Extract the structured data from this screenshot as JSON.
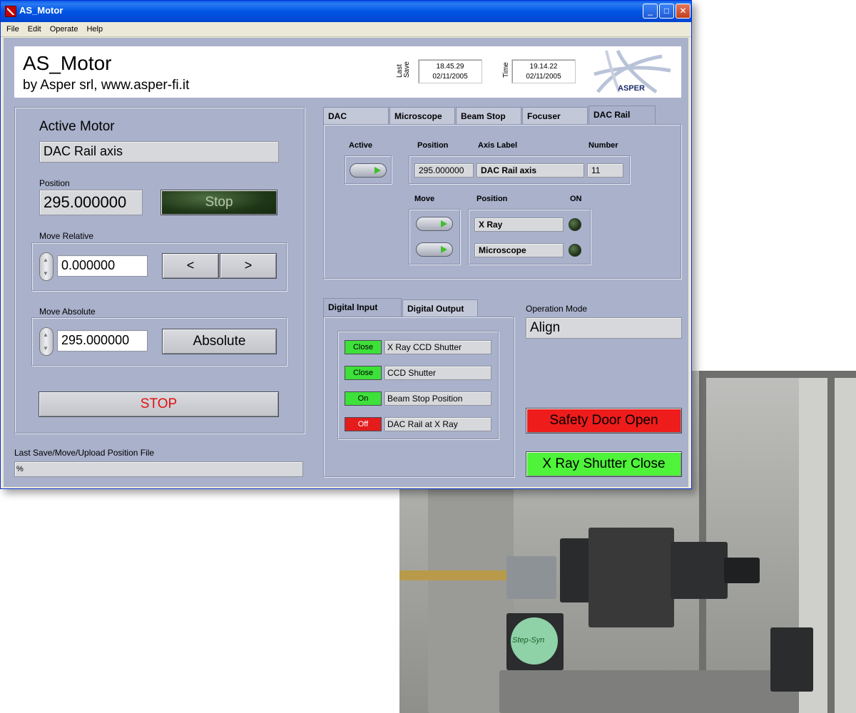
{
  "window": {
    "title": "AS_Motor",
    "buttons": [
      "_",
      "□",
      "✕"
    ]
  },
  "menu": [
    "File",
    "Edit",
    "Operate",
    "Help"
  ],
  "header": {
    "title": "AS_Motor",
    "subtitle": "by Asper srl, www.asper-fi.it",
    "last_save_label": "Last Save",
    "last_save_time": "18.45.29",
    "last_save_date": "02/11/2005",
    "time_label": "Time",
    "time_time": "19.14.22",
    "time_date": "02/11/2005",
    "logo_text": "ASPER"
  },
  "left": {
    "active_motor_label": "Active Motor",
    "active_motor_value": "DAC Rail axis",
    "position_label": "Position",
    "position_value": "295.000000",
    "stop_button": "Stop",
    "move_relative_label": "Move Relative",
    "move_relative_value": "0.000000",
    "left_button": "<",
    "right_button": ">",
    "move_absolute_label": "Move Absolute",
    "move_absolute_value": "295.000000",
    "absolute_button": "Absolute",
    "stop_all_button": "STOP",
    "last_file_label": "Last Save/Move/Upload Position File",
    "last_file_value": "%"
  },
  "axis_tabs": [
    "DAC",
    "Microscope",
    "Beam Stop",
    "Focuser",
    "DAC Rail"
  ],
  "dac_rail": {
    "active_label": "Active",
    "position_label": "Position",
    "axis_label_label": "Axis Label",
    "number_label": "Number",
    "position_value": "295.000000",
    "axis_label_value": "DAC Rail axis",
    "number_value": "11",
    "move_label": "Move",
    "position2_label": "Position",
    "on_label": "ON",
    "positions": [
      "X Ray",
      "Microscope"
    ]
  },
  "io_tabs": [
    "Digital Input",
    "Digital Output"
  ],
  "digital_inputs": [
    {
      "state": "Close",
      "label": "X Ray CCD Shutter",
      "color": "#3ee03a"
    },
    {
      "state": "Close",
      "label": "CCD Shutter",
      "color": "#3ee03a"
    },
    {
      "state": "On",
      "label": "Beam Stop Position",
      "color": "#3ee03a"
    },
    {
      "state": "Off",
      "label": "DAC Rail at X Ray",
      "color": "#e41c1c"
    }
  ],
  "operation_mode": {
    "label": "Operation Mode",
    "value": "Align"
  },
  "status": {
    "safety_door": "Safety Door Open",
    "safety_door_color": "#ef1c1c",
    "xray_shutter": "X Ray Shutter Close",
    "xray_shutter_color": "#4ef33a"
  },
  "photo": {
    "motor_label": "Step-Syn"
  }
}
